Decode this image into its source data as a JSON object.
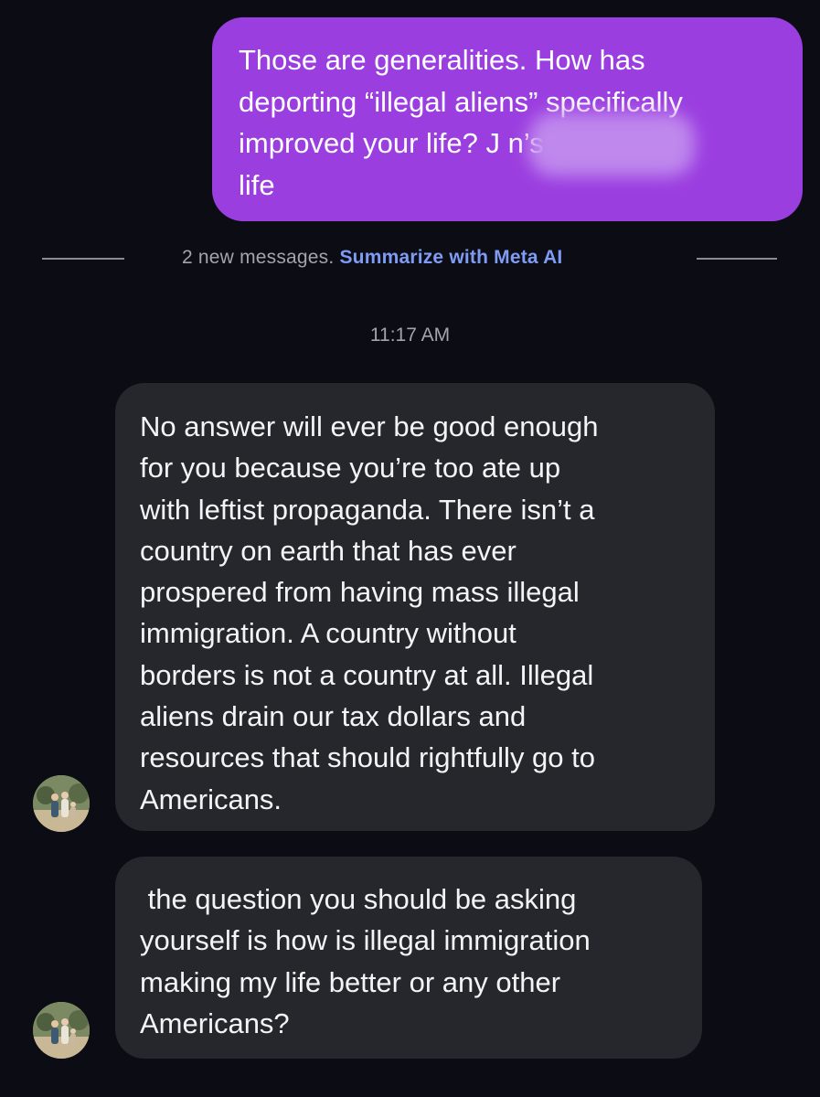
{
  "sent_message": {
    "lines": [
      "Those are generalities. How has",
      "deporting “illegal aliens” specifically",
      "improved your life? J              n’s",
      "life"
    ]
  },
  "divider": {
    "text": "2 new messages.",
    "link": "Summarize with Meta AI"
  },
  "timestamp": "11:17 AM",
  "received_messages": [
    {
      "lines": [
        "No answer will ever be good enough",
        "for you because you’re too ate up",
        "with leftist propaganda. There isn’t a",
        "country on earth that has ever",
        "prospered from having mass illegal",
        "immigration. A country without",
        "borders is not a country at all. Illegal",
        "aliens drain our tax dollars and",
        "resources that should rightfully go to",
        "Americans."
      ]
    },
    {
      "lines": [
        " the question you should be asking",
        "yourself is how is illegal immigration",
        "making my life better or any other",
        "Americans?"
      ]
    }
  ],
  "colors": {
    "background": "#0c0d14",
    "sent_bubble": "#9b3ee0",
    "received_bubble": "#25272c",
    "link": "#7f9cf5"
  },
  "icons": {
    "avatar": "profile-photo-avatar"
  }
}
